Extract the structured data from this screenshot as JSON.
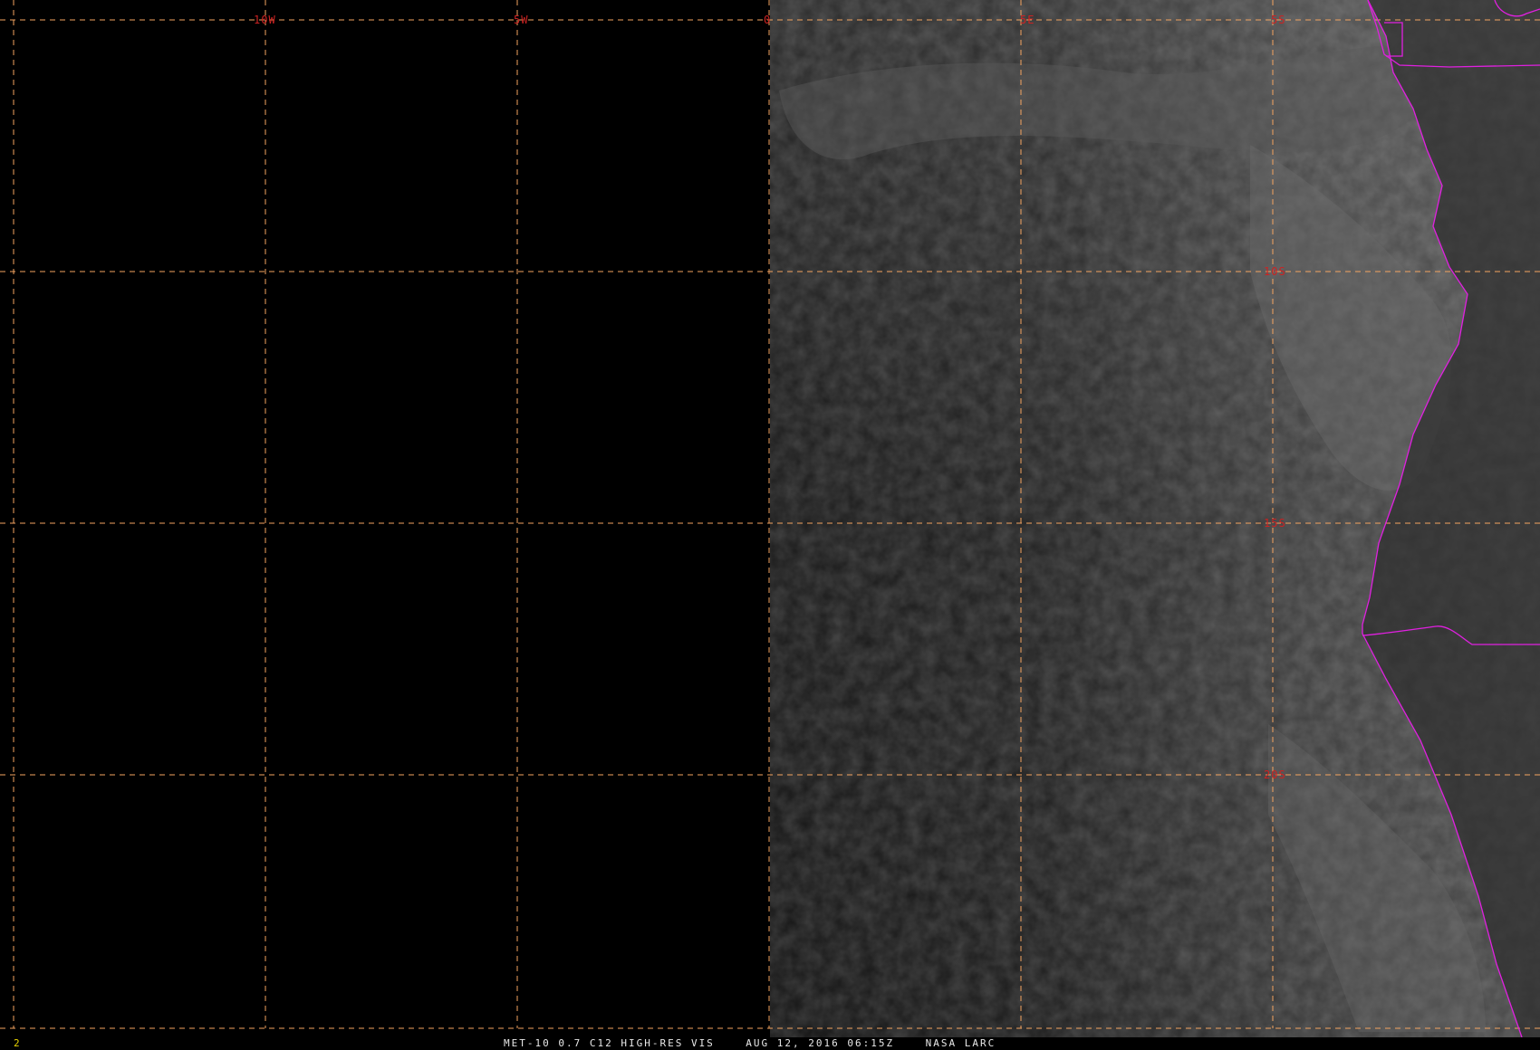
{
  "image": {
    "satellite": "MET-10",
    "product": "MET-10 0.7 C12 HIGH-RES VIS",
    "timestamp": "AUG 12, 2016 06:15Z",
    "source": "NASA LARC",
    "frame_number": "2"
  },
  "grid": {
    "line_color": "#f4a460",
    "label_color": "#cc2222",
    "longitude_labels": [
      "10W",
      "5W",
      "0",
      "5E",
      "5S"
    ],
    "latitude_labels": [
      "10S",
      "15S",
      "20S"
    ]
  },
  "overlays": {
    "boundary_color": "#e020e0",
    "features": [
      "coastline",
      "national-borders"
    ]
  },
  "caption_line": "MET-10 0.7 C12 HIGH-RES VIS    AUG 12, 2016 06:15Z    NASA LARC"
}
